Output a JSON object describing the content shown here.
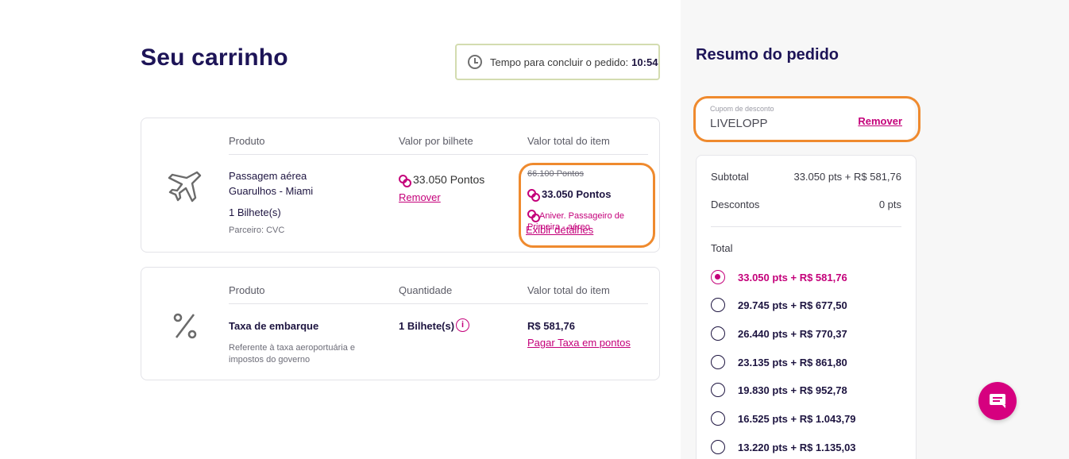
{
  "page": {
    "title": "Seu carrinho"
  },
  "timer": {
    "label": "Tempo para concluir o pedido:",
    "time": "10:54"
  },
  "flight_item": {
    "headers": {
      "product": "Produto",
      "unit_value": "Valor por bilhete",
      "total_value": "Valor total do item"
    },
    "product_name": "Passagem aérea",
    "route": "Guarulhos - Miami",
    "tickets": "1 Bilhete(s)",
    "partner": "Parceiro: CVC",
    "unit_points": "33.050 Pontos",
    "remove_label": "Remover",
    "old_points": "66.100 Pontos",
    "total_points": "33.050 Pontos",
    "promo": "Aniver. Passageiro de Primeira - aéreo",
    "details_label": "Exibir detalhes"
  },
  "tax_item": {
    "headers": {
      "product": "Produto",
      "quantity": "Quantidade",
      "total_value": "Valor total do item"
    },
    "product_name": "Taxa de embarque",
    "description": "Referente à taxa aeroportuária e impostos do governo",
    "quantity": "1 Bilhete(s)",
    "total": "R$ 581,76",
    "pay_points_label": "Pagar Taxa em pontos"
  },
  "summary": {
    "title": "Resumo do pedido",
    "coupon_label": "Cupom de desconto",
    "coupon_value": "LIVELOPP",
    "coupon_remove": "Remover",
    "subtotal_label": "Subtotal",
    "subtotal_value": "33.050 pts + R$ 581,76",
    "discount_label": "Descontos",
    "discount_value": "0 pts",
    "total_label": "Total",
    "options": [
      {
        "label": "33.050 pts + R$ 581,76",
        "selected": true
      },
      {
        "label": "29.745 pts + R$ 677,50",
        "selected": false
      },
      {
        "label": "26.440 pts + R$ 770,37",
        "selected": false
      },
      {
        "label": "23.135 pts + R$ 861,80",
        "selected": false
      },
      {
        "label": "19.830 pts + R$ 952,78",
        "selected": false
      },
      {
        "label": "16.525 pts + R$ 1.043,79",
        "selected": false
      },
      {
        "label": "13.220 pts + R$ 1.135,03",
        "selected": false
      }
    ]
  },
  "colors": {
    "brand_pink": "#c4007a",
    "highlight_orange": "#ef8a2e",
    "title_navy": "#1d1457"
  },
  "icons": {
    "timer": "clock-icon",
    "flight": "airplane-icon",
    "tax": "percent-icon",
    "points": "points-icon",
    "chat": "chat-icon"
  }
}
